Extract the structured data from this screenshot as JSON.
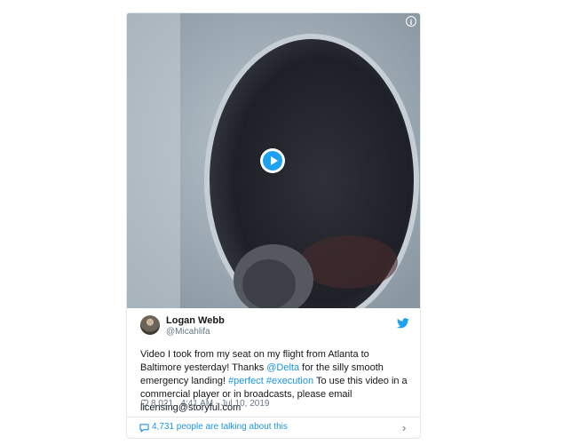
{
  "media": {
    "info_symbol": "i",
    "play_label": "play-icon"
  },
  "tweet": {
    "name": "Logan Webb",
    "handle": "@Micahlifa",
    "text_parts": {
      "p1": "Video I took from my seat on my flight from Atlanta to Baltimore yesterday! Thanks ",
      "mention": "@Delta",
      "p2": " for the silly smooth emergency landing! ",
      "tag1": "#perfect",
      "tag2": "#execution",
      "p3": " To use this video in a commercial player or in broadcasts, please email licensing@storyful.com"
    },
    "likes": "8,021",
    "timestamp": "4:41 AM - Jul 10, 2019"
  },
  "footer": {
    "talking": "4,731 people are talking about this",
    "chevron": "›"
  },
  "colors": {
    "link": "#1b95e0",
    "twitter_blue": "#1da1f2"
  }
}
